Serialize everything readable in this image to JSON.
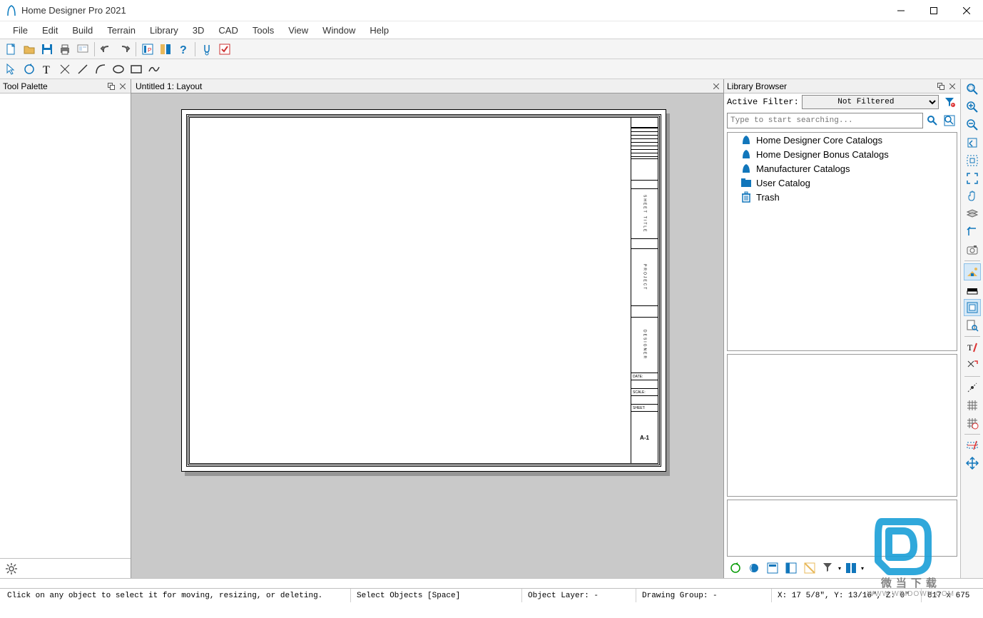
{
  "app": {
    "title": "Home Designer Pro 2021"
  },
  "menu": [
    "File",
    "Edit",
    "Build",
    "Terrain",
    "Library",
    "3D",
    "CAD",
    "Tools",
    "View",
    "Window",
    "Help"
  ],
  "panels": {
    "toolPalette": "Tool Palette",
    "library": "Library Browser"
  },
  "doc": {
    "tab": "Untitled 1: Layout"
  },
  "titleblock": {
    "labels": {
      "date": "DATE:",
      "scale": "SCALE:",
      "sheet_lbl": "SHEET:",
      "sheet": "A-1",
      "sheet_title": "SHEET TITLE",
      "project": "PROJECT",
      "designer": "DESIGNER"
    }
  },
  "lib": {
    "filterLabel": "Active Filter:",
    "filterValue": "Not Filtered",
    "searchPlaceholder": "Type to start searching...",
    "items": [
      {
        "label": "Home Designer Core Catalogs",
        "icon": "catalog"
      },
      {
        "label": "Home Designer Bonus Catalogs",
        "icon": "catalog"
      },
      {
        "label": "Manufacturer Catalogs",
        "icon": "catalog"
      },
      {
        "label": "User Catalog",
        "icon": "folder"
      },
      {
        "label": "Trash",
        "icon": "trash"
      }
    ]
  },
  "status": {
    "hint": "Click on any object to select it for moving, resizing, or deleting.",
    "mode": "Select Objects [Space]",
    "layer": "Object Layer: -",
    "group": "Drawing Group: -",
    "coords": "X: 17 5/8\", Y: 13/16\", Z: 0\"",
    "size": "817 x 675"
  },
  "watermark": {
    "brand": "微当下载",
    "url": "WWW.WEIDOWN.COM"
  }
}
